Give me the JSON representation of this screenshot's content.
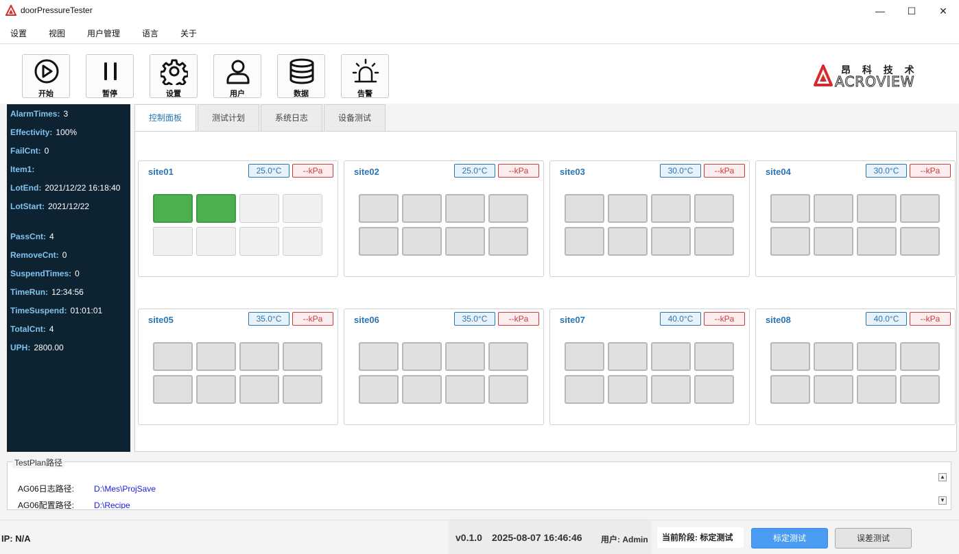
{
  "window": {
    "title": "doorPressureTester",
    "minimize_glyph": "—",
    "maximize_glyph": "☐",
    "close_glyph": "✕"
  },
  "menu": [
    "设置",
    "视图",
    "用户管理",
    "语言",
    "关于"
  ],
  "toolbar": [
    {
      "label": "开始",
      "icon": "play-icon"
    },
    {
      "label": "暂停",
      "icon": "pause-icon"
    },
    {
      "label": "设置",
      "icon": "gear-icon"
    },
    {
      "label": "用户",
      "icon": "user-icon"
    },
    {
      "label": "数据",
      "icon": "database-icon"
    },
    {
      "label": "告警",
      "icon": "alarm-icon"
    }
  ],
  "brand": {
    "cn": "昂 科 技 术",
    "en": "ACROVIEW",
    "color": "#d42a2a"
  },
  "stats": [
    {
      "key": "AlarmTimes:",
      "value": "3"
    },
    {
      "key": "Effectivity:",
      "value": "100%"
    },
    {
      "key": "FailCnt:",
      "value": "0"
    },
    {
      "key": "Item1:",
      "value": ""
    },
    {
      "key": "LotEnd:",
      "value": "2021/12/22 16:18:40"
    },
    {
      "key": "LotStart:",
      "value": "2021/12/22"
    },
    {
      "key": "PassCnt:",
      "value": "4"
    },
    {
      "key": "RemoveCnt:",
      "value": "0"
    },
    {
      "key": "SuspendTimes:",
      "value": "0"
    },
    {
      "key": "TimeRun:",
      "value": "12:34:56"
    },
    {
      "key": "TimeSuspend:",
      "value": "01:01:01"
    },
    {
      "key": "TotalCnt:",
      "value": "4"
    },
    {
      "key": "UPH:",
      "value": "2800.00"
    }
  ],
  "tabs": [
    {
      "label": "控制面板",
      "active": true
    },
    {
      "label": "测试计划",
      "active": false
    },
    {
      "label": "系统日志",
      "active": false
    },
    {
      "label": "设备测试",
      "active": false
    }
  ],
  "sites": [
    {
      "name": "site01",
      "temp": "25.0°C",
      "pressure": "--kPa",
      "cells": [
        "pass",
        "pass",
        "idle",
        "idle",
        "idle",
        "idle",
        "idle",
        "idle"
      ]
    },
    {
      "name": "site02",
      "temp": "25.0°C",
      "pressure": "--kPa",
      "cells": [
        "off",
        "off",
        "off",
        "off",
        "off",
        "off",
        "off",
        "off"
      ]
    },
    {
      "name": "site03",
      "temp": "30.0°C",
      "pressure": "--kPa",
      "cells": [
        "off",
        "off",
        "off",
        "off",
        "off",
        "off",
        "off",
        "off"
      ]
    },
    {
      "name": "site04",
      "temp": "30.0°C",
      "pressure": "--kPa",
      "cells": [
        "off",
        "off",
        "off",
        "off",
        "off",
        "off",
        "off",
        "off"
      ]
    },
    {
      "name": "site05",
      "temp": "35.0°C",
      "pressure": "--kPa",
      "cells": [
        "off",
        "off",
        "off",
        "off",
        "off",
        "off",
        "off",
        "off"
      ]
    },
    {
      "name": "site06",
      "temp": "35.0°C",
      "pressure": "--kPa",
      "cells": [
        "off",
        "off",
        "off",
        "off",
        "off",
        "off",
        "off",
        "off"
      ]
    },
    {
      "name": "site07",
      "temp": "40.0°C",
      "pressure": "--kPa",
      "cells": [
        "off",
        "off",
        "off",
        "off",
        "off",
        "off",
        "off",
        "off"
      ]
    },
    {
      "name": "site08",
      "temp": "40.0°C",
      "pressure": "--kPa",
      "cells": [
        "off",
        "off",
        "off",
        "off",
        "off",
        "off",
        "off",
        "off"
      ]
    }
  ],
  "testplan": {
    "title": "TestPlan路径",
    "rows": [
      {
        "key": "AG06日志路径:",
        "value": "D:\\Mes\\ProjSave"
      },
      {
        "key": "AG06配置路径:",
        "value": "D:\\Recipe"
      }
    ],
    "scroll_up": "▲",
    "scroll_down": "▼"
  },
  "statusbar": {
    "ip": "IP: N/A",
    "version": "v0.1.0",
    "datetime": "2025-08-07 16:46:46",
    "user": "用户: Admin",
    "stage": "当前阶段: 标定测试",
    "calib_button": "标定测试",
    "error_button": "误差测试"
  },
  "colors": {
    "accent": "#2a74b3",
    "panel_bg": "#0e2332",
    "pass": "#4caf50",
    "alarm": "#d03a3a",
    "primary_button": "#4a9bf2"
  }
}
